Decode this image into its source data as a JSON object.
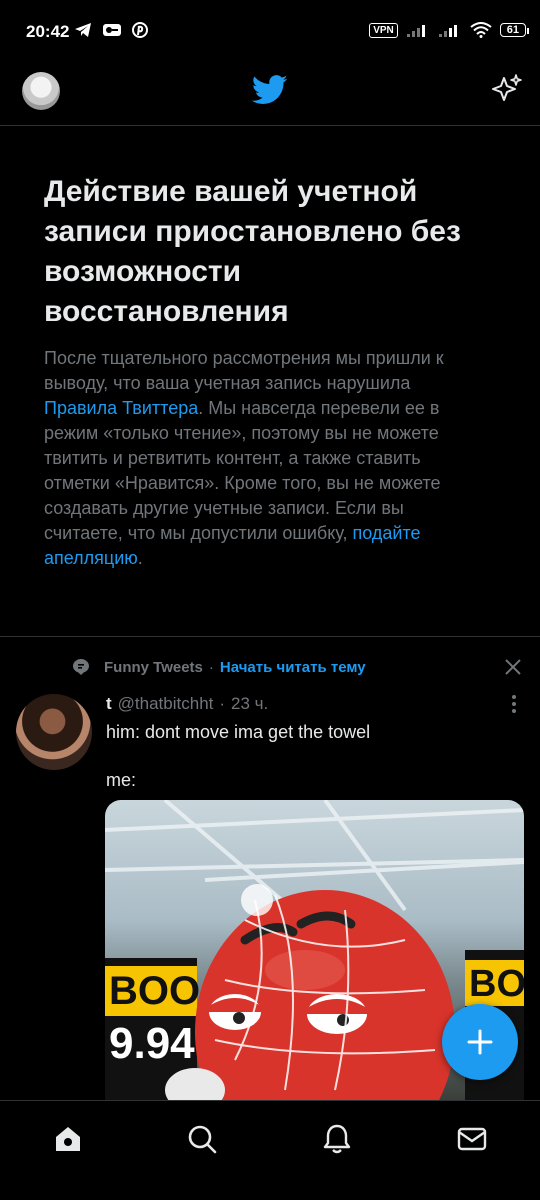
{
  "status_bar": {
    "time": "20:42",
    "left_icons": [
      "telegram-icon",
      "key-icon",
      "pinterest-icon"
    ],
    "vpn": "VPN",
    "battery": "61"
  },
  "top_nav": {
    "logo": "twitter-bird-icon",
    "sparkle": "sparkle-icon"
  },
  "notice": {
    "title": "Действие вашей учетной записи приостановлено без возможности восстановления",
    "body_1": "После тщательного рассмотрения мы пришли к выводу, что ваша учетная запись нарушила ",
    "rules_link": "Правила Твиттера",
    "body_2": ". Мы навсегда перевели ее в режим «только чтение», поэтому вы не можете твитить и ретвитить контент, а также ставить отметки «Нравится». Кроме того, вы не можете создавать другие учетные записи. Если вы считаете, что мы допустили ошибку, ",
    "appeal_link": "подайте апелляцию",
    "body_3": "."
  },
  "tweet": {
    "topic_name": "Funny Tweets",
    "topic_sep": "·",
    "topic_follow": "Начать читать тему",
    "author_name": "t",
    "author_handle": "@thatbitchht",
    "time_sep": "·",
    "time": "23 ч.",
    "text": "him: dont move ima get the towel\n\nme:"
  },
  "colors": {
    "accent": "#1d9bf0",
    "background": "#000000",
    "muted": "#71767b"
  }
}
